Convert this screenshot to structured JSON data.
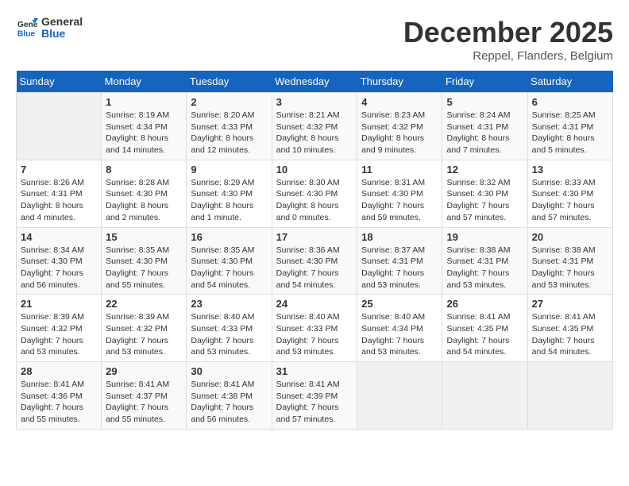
{
  "logo": {
    "line1": "General",
    "line2": "Blue"
  },
  "title": "December 2025",
  "subtitle": "Reppel, Flanders, Belgium",
  "weekdays": [
    "Sunday",
    "Monday",
    "Tuesday",
    "Wednesday",
    "Thursday",
    "Friday",
    "Saturday"
  ],
  "weeks": [
    [
      {
        "day": "",
        "info": ""
      },
      {
        "day": "1",
        "info": "Sunrise: 8:19 AM\nSunset: 4:34 PM\nDaylight: 8 hours\nand 14 minutes."
      },
      {
        "day": "2",
        "info": "Sunrise: 8:20 AM\nSunset: 4:33 PM\nDaylight: 8 hours\nand 12 minutes."
      },
      {
        "day": "3",
        "info": "Sunrise: 8:21 AM\nSunset: 4:32 PM\nDaylight: 8 hours\nand 10 minutes."
      },
      {
        "day": "4",
        "info": "Sunrise: 8:23 AM\nSunset: 4:32 PM\nDaylight: 8 hours\nand 9 minutes."
      },
      {
        "day": "5",
        "info": "Sunrise: 8:24 AM\nSunset: 4:31 PM\nDaylight: 8 hours\nand 7 minutes."
      },
      {
        "day": "6",
        "info": "Sunrise: 8:25 AM\nSunset: 4:31 PM\nDaylight: 8 hours\nand 5 minutes."
      }
    ],
    [
      {
        "day": "7",
        "info": "Sunrise: 8:26 AM\nSunset: 4:31 PM\nDaylight: 8 hours\nand 4 minutes."
      },
      {
        "day": "8",
        "info": "Sunrise: 8:28 AM\nSunset: 4:30 PM\nDaylight: 8 hours\nand 2 minutes."
      },
      {
        "day": "9",
        "info": "Sunrise: 8:29 AM\nSunset: 4:30 PM\nDaylight: 8 hours\nand 1 minute."
      },
      {
        "day": "10",
        "info": "Sunrise: 8:30 AM\nSunset: 4:30 PM\nDaylight: 8 hours\nand 0 minutes."
      },
      {
        "day": "11",
        "info": "Sunrise: 8:31 AM\nSunset: 4:30 PM\nDaylight: 7 hours\nand 59 minutes."
      },
      {
        "day": "12",
        "info": "Sunrise: 8:32 AM\nSunset: 4:30 PM\nDaylight: 7 hours\nand 57 minutes."
      },
      {
        "day": "13",
        "info": "Sunrise: 8:33 AM\nSunset: 4:30 PM\nDaylight: 7 hours\nand 57 minutes."
      }
    ],
    [
      {
        "day": "14",
        "info": "Sunrise: 8:34 AM\nSunset: 4:30 PM\nDaylight: 7 hours\nand 56 minutes."
      },
      {
        "day": "15",
        "info": "Sunrise: 8:35 AM\nSunset: 4:30 PM\nDaylight: 7 hours\nand 55 minutes."
      },
      {
        "day": "16",
        "info": "Sunrise: 8:35 AM\nSunset: 4:30 PM\nDaylight: 7 hours\nand 54 minutes."
      },
      {
        "day": "17",
        "info": "Sunrise: 8:36 AM\nSunset: 4:30 PM\nDaylight: 7 hours\nand 54 minutes."
      },
      {
        "day": "18",
        "info": "Sunrise: 8:37 AM\nSunset: 4:31 PM\nDaylight: 7 hours\nand 53 minutes."
      },
      {
        "day": "19",
        "info": "Sunrise: 8:38 AM\nSunset: 4:31 PM\nDaylight: 7 hours\nand 53 minutes."
      },
      {
        "day": "20",
        "info": "Sunrise: 8:38 AM\nSunset: 4:31 PM\nDaylight: 7 hours\nand 53 minutes."
      }
    ],
    [
      {
        "day": "21",
        "info": "Sunrise: 8:39 AM\nSunset: 4:32 PM\nDaylight: 7 hours\nand 53 minutes."
      },
      {
        "day": "22",
        "info": "Sunrise: 8:39 AM\nSunset: 4:32 PM\nDaylight: 7 hours\nand 53 minutes."
      },
      {
        "day": "23",
        "info": "Sunrise: 8:40 AM\nSunset: 4:33 PM\nDaylight: 7 hours\nand 53 minutes."
      },
      {
        "day": "24",
        "info": "Sunrise: 8:40 AM\nSunset: 4:33 PM\nDaylight: 7 hours\nand 53 minutes."
      },
      {
        "day": "25",
        "info": "Sunrise: 8:40 AM\nSunset: 4:34 PM\nDaylight: 7 hours\nand 53 minutes."
      },
      {
        "day": "26",
        "info": "Sunrise: 8:41 AM\nSunset: 4:35 PM\nDaylight: 7 hours\nand 54 minutes."
      },
      {
        "day": "27",
        "info": "Sunrise: 8:41 AM\nSunset: 4:35 PM\nDaylight: 7 hours\nand 54 minutes."
      }
    ],
    [
      {
        "day": "28",
        "info": "Sunrise: 8:41 AM\nSunset: 4:36 PM\nDaylight: 7 hours\nand 55 minutes."
      },
      {
        "day": "29",
        "info": "Sunrise: 8:41 AM\nSunset: 4:37 PM\nDaylight: 7 hours\nand 55 minutes."
      },
      {
        "day": "30",
        "info": "Sunrise: 8:41 AM\nSunset: 4:38 PM\nDaylight: 7 hours\nand 56 minutes."
      },
      {
        "day": "31",
        "info": "Sunrise: 8:41 AM\nSunset: 4:39 PM\nDaylight: 7 hours\nand 57 minutes."
      },
      {
        "day": "",
        "info": ""
      },
      {
        "day": "",
        "info": ""
      },
      {
        "day": "",
        "info": ""
      }
    ]
  ]
}
